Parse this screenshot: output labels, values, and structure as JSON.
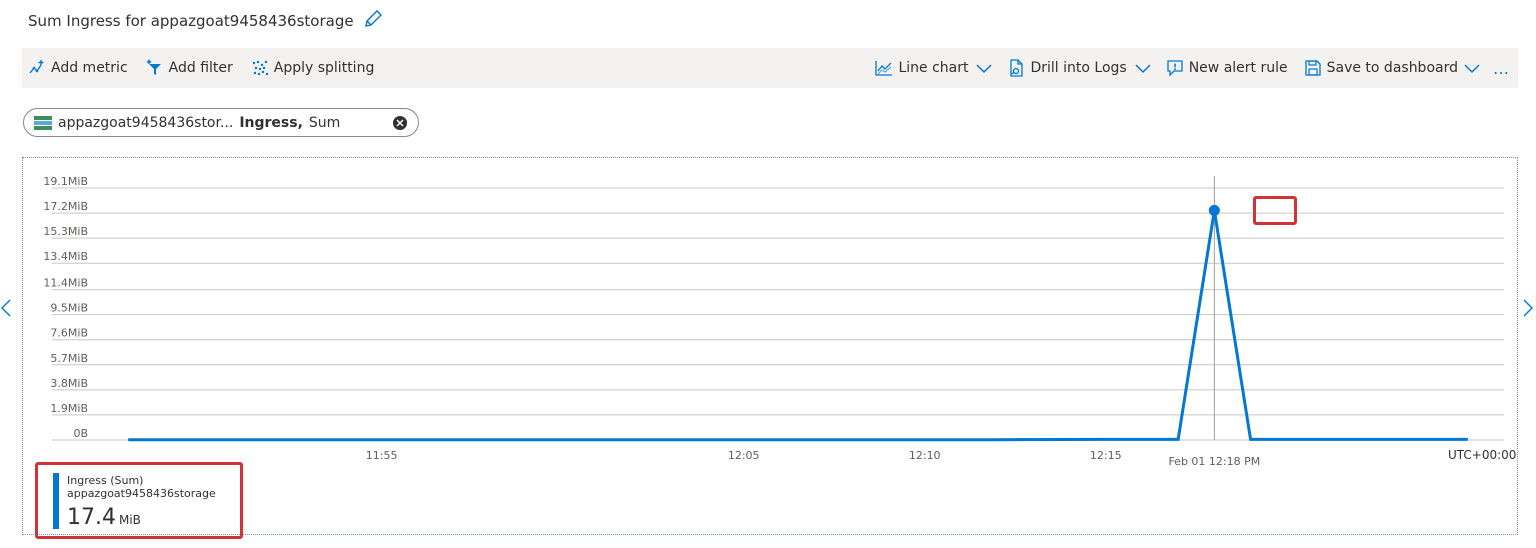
{
  "title": "Sum Ingress for appazgoat9458436storage",
  "toolbar": {
    "add_metric": "Add metric",
    "add_filter": "Add filter",
    "apply_splitting": "Apply splitting",
    "line_chart": "Line chart",
    "drill_into_logs": "Drill into Logs",
    "new_alert_rule": "New alert rule",
    "save_to_dashboard": "Save to dashboard",
    "more": "…"
  },
  "metric_pill": {
    "resource": "appazgoat9458436stor...",
    "metric": "Ingress,",
    "aggregation": "Sum"
  },
  "colors": {
    "accent": "#0078d4",
    "highlight": "#d13438"
  },
  "chart_data": {
    "type": "line",
    "y_ticks": [
      "0B",
      "1.9MiB",
      "3.8MiB",
      "5.7MiB",
      "7.6MiB",
      "9.5MiB",
      "11.4MiB",
      "13.4MiB",
      "15.3MiB",
      "17.2MiB",
      "19.1MiB"
    ],
    "y_tick_values": [
      0,
      1.9,
      3.8,
      5.7,
      7.6,
      9.5,
      11.4,
      13.4,
      15.3,
      17.2,
      19.1
    ],
    "ylim": [
      0,
      19.1
    ],
    "y_unit": "MiB",
    "x_ticks": [
      "11:55",
      "12:05",
      "12:10",
      "12:15"
    ],
    "x_tick_minutes": [
      235,
      245,
      250,
      255
    ],
    "xlim": [
      227,
      266
    ],
    "hover_label": "Feb 01 12:18 PM",
    "hover_minute": 258,
    "timezone_label": "UTC+00:00",
    "series": [
      {
        "name": "Ingress (Sum)",
        "x_minutes": [
          228,
          235,
          245,
          250,
          252,
          255,
          256,
          257,
          258,
          259,
          260,
          265
        ],
        "values": [
          0.02,
          0.02,
          0.02,
          0.02,
          0.02,
          0.05,
          0.05,
          0.05,
          17.4,
          0.05,
          0.05,
          0.05
        ]
      }
    ],
    "grid": true
  },
  "legend": {
    "metric": "Ingress (Sum)",
    "resource": "appazgoat9458436storage",
    "value": "17.4",
    "unit": "MiB"
  }
}
